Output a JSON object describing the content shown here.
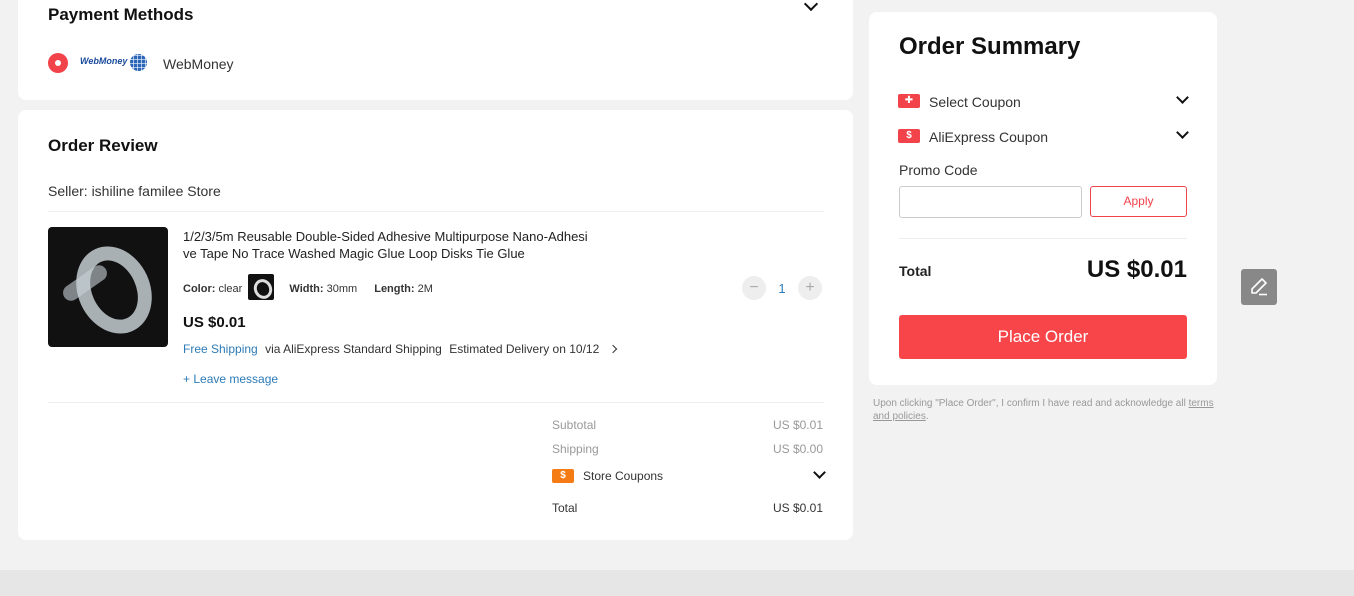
{
  "payment": {
    "title": "Payment Methods",
    "method_logo_text": "WebMoney",
    "method_name": "WebMoney"
  },
  "review": {
    "title": "Order Review",
    "seller": "Seller: ishiline familee Store",
    "product": {
      "title": "1/2/3/5m Reusable Double-Sided Adhesive Multipurpose Nano-Adhesive Tape No Trace Washed Magic Glue Loop Disks Tie Glue",
      "title_line1": "1/2/3/5m Reusable Double-Sided Adhesive Multipurpose Nano-Adhesi",
      "title_line2": "ve Tape No Trace Washed Magic Glue Loop Disks Tie Glue",
      "color_label": "Color:",
      "color_value": "clear",
      "width_label": "Width:",
      "width_value": "30mm",
      "length_label": "Length:",
      "length_value": "2M",
      "price": "US $0.01",
      "free_shipping": "Free Shipping",
      "shipping_via": "via AliExpress Standard Shipping",
      "estimated_delivery": "Estimated Delivery on 10/12",
      "leave_message": "+ Leave message",
      "quantity": "1",
      "qty_minus": "−",
      "qty_plus": "+"
    },
    "totals": {
      "subtotal_label": "Subtotal",
      "subtotal_value": "US $0.01",
      "shipping_label": "Shipping",
      "shipping_value": "US $0.00",
      "store_coupons_label": "Store Coupons",
      "total_label": "Total",
      "total_value": "US $0.01"
    }
  },
  "summary": {
    "title": "Order Summary",
    "select_coupon": "Select Coupon",
    "aliexpress_coupon": "AliExpress Coupon",
    "promo_label": "Promo Code",
    "promo_placeholder": "",
    "apply_label": "Apply",
    "total_label": "Total",
    "total_value": "US $0.01",
    "place_order": "Place Order",
    "legal_text": "Upon clicking \"Place Order\", I confirm I have read and acknowledge all",
    "legal_link": "terms and policies",
    "legal_end": "."
  },
  "icons": {
    "coupon_glyph": "$"
  },
  "colors": {
    "accent": "#f7454a",
    "link": "#2d7bb6",
    "store_coupon": "#f57c14"
  }
}
